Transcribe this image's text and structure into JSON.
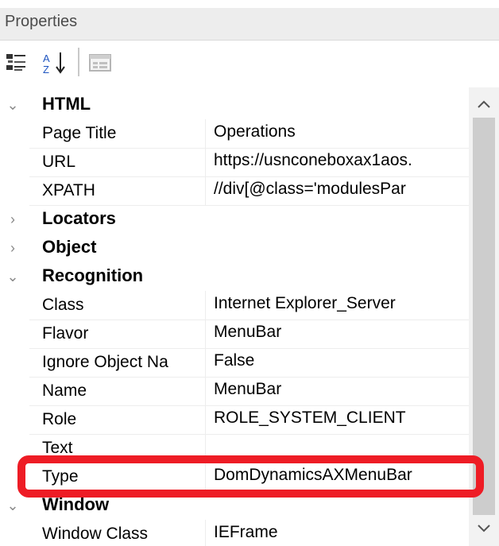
{
  "panel": {
    "title": "Properties"
  },
  "toolbar": {
    "categorized_icon": "categorized-icon",
    "alphabetical_icon": "sort-az-icon",
    "property_pages_icon": "property-pages-icon"
  },
  "categories": [
    {
      "name": "HTML",
      "expanded": true,
      "properties": [
        {
          "name": "Page Title",
          "value": "Operations"
        },
        {
          "name": "URL",
          "value": "https://usnconeboxax1aos."
        },
        {
          "name": "XPATH",
          "value": "//div[@class='modulesPar"
        }
      ]
    },
    {
      "name": "Locators",
      "expanded": false,
      "properties": []
    },
    {
      "name": "Object",
      "expanded": false,
      "properties": []
    },
    {
      "name": "Recognition",
      "expanded": true,
      "properties": [
        {
          "name": "Class",
          "value": "Internet Explorer_Server"
        },
        {
          "name": "Flavor",
          "value": "MenuBar"
        },
        {
          "name": "Ignore Object Na",
          "value": "False"
        },
        {
          "name": "Name",
          "value": "MenuBar"
        },
        {
          "name": "Role",
          "value": "ROLE_SYSTEM_CLIENT"
        },
        {
          "name": "Text",
          "value": ""
        },
        {
          "name": "Type",
          "value": "DomDynamicsAXMenuBar"
        }
      ]
    },
    {
      "name": "Window",
      "expanded": true,
      "properties": [
        {
          "name": "Window Class",
          "value": "IEFrame"
        }
      ]
    }
  ],
  "highlight": {
    "color": "#ee1c25",
    "target": "Type"
  },
  "colors": {
    "header_bg": "#ededed",
    "scrollbar_bg": "#f2f2f2",
    "scroll_thumb": "#cdcdcd"
  }
}
